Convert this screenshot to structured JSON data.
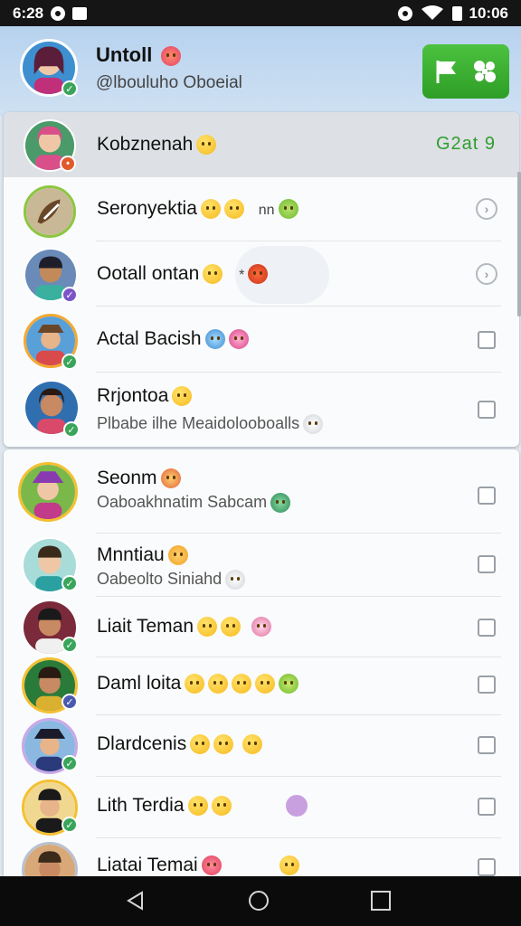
{
  "status": {
    "time_left": "6:28",
    "time_right": "10:06"
  },
  "header": {
    "title": "Untoll",
    "handle": "@lbouluho Oboeial"
  },
  "list1": [
    {
      "name": "Kobznenah",
      "sub": "",
      "tag": "G2at 9",
      "control": "none",
      "active": true,
      "avatar_color": "#d94f8a",
      "badge_color": "#e05a2b"
    },
    {
      "name": "Seronyektia",
      "sub": "",
      "extra": "nn",
      "control": "chevron",
      "active": false,
      "avatar_color": "#8a6a3a",
      "badge_color": ""
    },
    {
      "name": "Ootall ontan",
      "sub": "",
      "extra": "*",
      "control": "chevron",
      "active": false,
      "avatar_color": "#3a4a7a",
      "badge_color": "#7b55c8"
    },
    {
      "name": "Actal Bacish",
      "sub": "",
      "control": "checkbox",
      "active": false,
      "avatar_color": "#c27a3a",
      "badge_color": "#3aa55a"
    },
    {
      "name": "Rrjontoa",
      "sub": "Plbabe ilhe Meaidolooboalls",
      "control": "checkbox",
      "active": false,
      "avatar_color": "#2f6fb0",
      "badge_color": "#3aa55a"
    }
  ],
  "list2": [
    {
      "name": "Seonm",
      "sub": "Oaboakhnatim Sabcam",
      "control": "checkbox",
      "avatar_color": "#c23a8a",
      "badge_color": ""
    },
    {
      "name": "Mnntiau",
      "sub": "Oabeolto Siniahd",
      "control": "checkbox",
      "avatar_color": "#2aa0a0",
      "badge_color": "#3aa55a"
    },
    {
      "name": "Liait Teman",
      "sub": "",
      "control": "checkbox",
      "avatar_color": "#7a2a3a",
      "badge_color": "#3aa55a"
    },
    {
      "name": "Daml loita",
      "sub": "",
      "control": "checkbox",
      "avatar_color": "#2a7a3a",
      "badge_color": "#4a5ab0"
    },
    {
      "name": "Dlardcenis",
      "sub": "",
      "control": "checkbox",
      "avatar_color": "#2a3a7a",
      "badge_color": "#3aa55a"
    },
    {
      "name": "Lith Terdia",
      "sub": "",
      "control": "checkbox",
      "avatar_color": "#d9b030",
      "badge_color": "#3aa55a"
    },
    {
      "name": "Liatai Temai",
      "sub": "",
      "control": "checkbox",
      "avatar_color": "#8a5a3a",
      "badge_color": ""
    }
  ],
  "colors": {
    "accent_green": "#3aa53a",
    "header_bg": "#cfe1f3"
  }
}
